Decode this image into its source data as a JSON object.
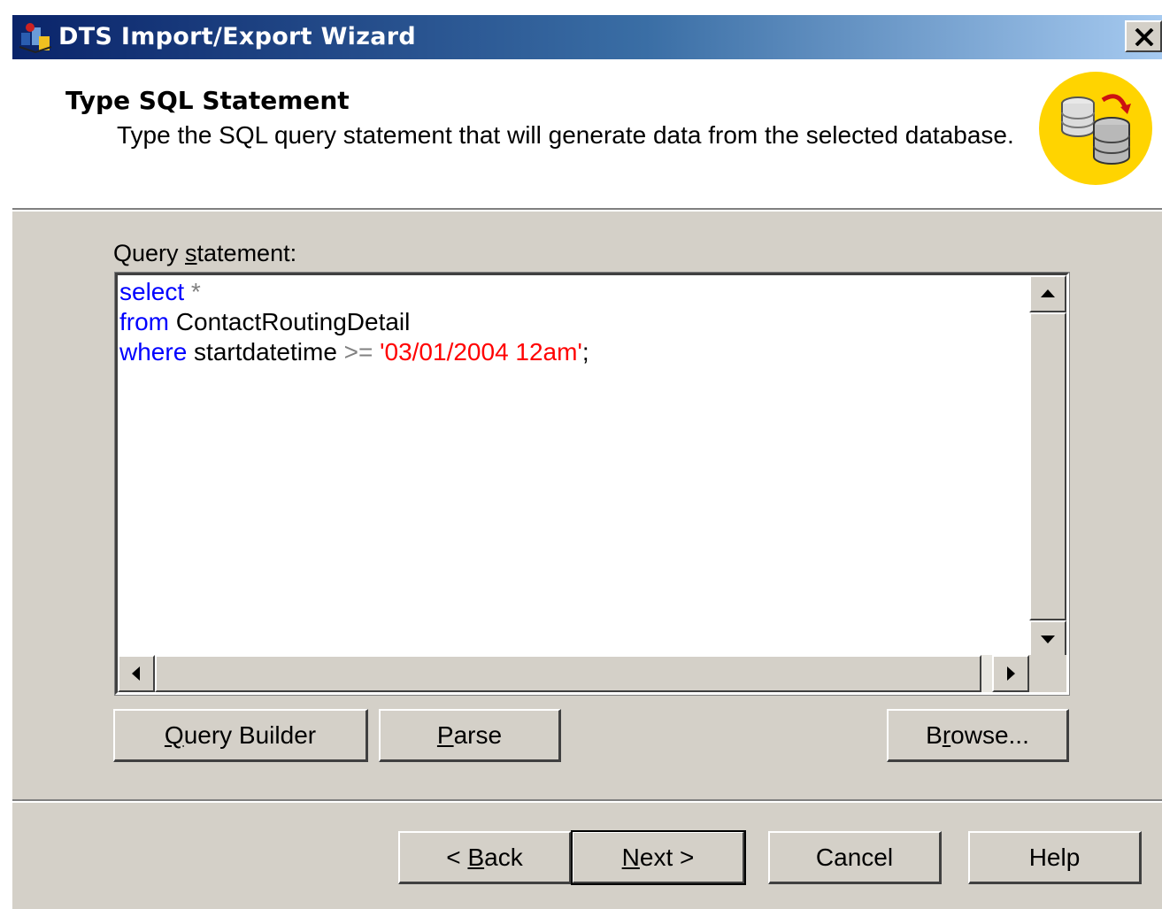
{
  "window": {
    "title": "DTS Import/Export Wizard"
  },
  "header": {
    "title": "Type SQL Statement",
    "subtitle": "Type the SQL query statement that will generate data from the selected database."
  },
  "query": {
    "label_prefix": "Query ",
    "label_accel": "s",
    "label_rest": "tatement:",
    "lines": [
      {
        "kw": "select",
        "op": " *"
      },
      {
        "kw": "from",
        "txt": " ContactRoutingDetail"
      },
      {
        "kw": "where",
        "txt": " startdatetime ",
        "op": ">=",
        "str": " '03/01/2004 12am'",
        "tail": ";"
      }
    ]
  },
  "buttons": {
    "query_builder": {
      "accel": "Q",
      "rest": "uery Builder"
    },
    "parse": {
      "accel": "P",
      "rest": "arse"
    },
    "browse": {
      "pre": "B",
      "accel": "r",
      "rest": "owse..."
    },
    "back": {
      "pre": "< ",
      "accel": "B",
      "rest": "ack"
    },
    "next": {
      "accel": "N",
      "rest": "ext >"
    },
    "cancel": "Cancel",
    "help": "Help"
  },
  "icons": {
    "app": "dts-wizard-icon",
    "header": "database-transfer-icon",
    "close": "close-icon"
  },
  "colors": {
    "keyword": "#0000ff",
    "string": "#ff0000",
    "titlebar_start": "#0a246a",
    "titlebar_end": "#a6caf0",
    "icon_circle": "#ffd400"
  }
}
